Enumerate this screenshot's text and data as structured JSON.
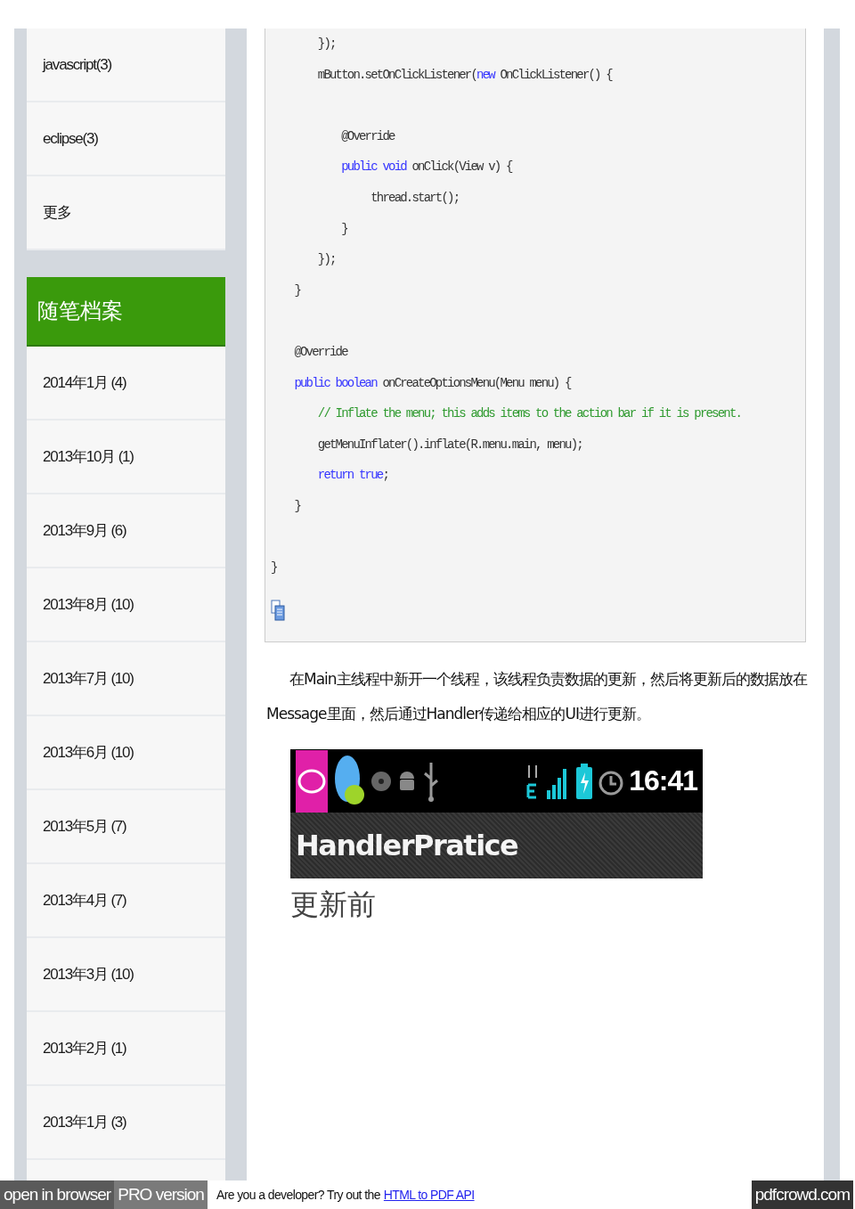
{
  "sidebar": {
    "categories": [
      {
        "label": "javascript(3)"
      },
      {
        "label": "eclipse(3)"
      },
      {
        "label": "更多"
      }
    ],
    "archive": {
      "title": "随笔档案",
      "items": [
        {
          "label": "2014年1月 (4)"
        },
        {
          "label": "2013年10月 (1)"
        },
        {
          "label": "2013年9月 (6)"
        },
        {
          "label": "2013年8月 (10)"
        },
        {
          "label": "2013年7月 (10)"
        },
        {
          "label": "2013年6月 (10)"
        },
        {
          "label": "2013年5月 (7)"
        },
        {
          "label": "2013年4月 (7)"
        },
        {
          "label": "2013年3月 (10)"
        },
        {
          "label": "2013年2月 (1)"
        },
        {
          "label": "2013年1月 (3)"
        }
      ]
    }
  },
  "code": {
    "lines": [
      {
        "kind": "code",
        "tokens": [
          {
            "text": "        });",
            "kind": "plain"
          }
        ]
      },
      {
        "kind": "code",
        "tokens": [
          {
            "text": "        mButton.setOnClickListener(",
            "kind": "plain"
          },
          {
            "text": "new",
            "kind": "keyword"
          },
          {
            "text": " OnClickListener() {",
            "kind": "plain"
          }
        ]
      },
      {
        "kind": "blank"
      },
      {
        "kind": "code",
        "tokens": [
          {
            "text": "            @Override",
            "kind": "plain"
          }
        ]
      },
      {
        "kind": "code",
        "tokens": [
          {
            "text": "            public void",
            "kind": "keyword"
          },
          {
            "text": " onClick(View v) {",
            "kind": "plain"
          }
        ]
      },
      {
        "kind": "code",
        "tokens": [
          {
            "text": "                 thread.start();",
            "kind": "plain"
          }
        ]
      },
      {
        "kind": "code",
        "tokens": [
          {
            "text": "            }",
            "kind": "plain"
          }
        ]
      },
      {
        "kind": "code",
        "tokens": [
          {
            "text": "        });",
            "kind": "plain"
          }
        ]
      },
      {
        "kind": "code",
        "tokens": [
          {
            "text": "    }",
            "kind": "plain"
          }
        ]
      },
      {
        "kind": "blank"
      },
      {
        "kind": "code",
        "tokens": [
          {
            "text": "    @Override",
            "kind": "plain"
          }
        ]
      },
      {
        "kind": "code",
        "tokens": [
          {
            "text": "    public boolean",
            "kind": "keyword"
          },
          {
            "text": " onCreateOptionsMenu(Menu menu) {",
            "kind": "plain"
          }
        ]
      },
      {
        "kind": "code",
        "tokens": [
          {
            "text": "        // Inflate the menu; this adds items to the action bar if it is present.",
            "kind": "comment"
          }
        ]
      },
      {
        "kind": "code",
        "tokens": [
          {
            "text": "        getMenuInflater().inflate(R.menu.main, menu);",
            "kind": "plain"
          }
        ]
      },
      {
        "kind": "code",
        "tokens": [
          {
            "text": "        return true",
            "kind": "keyword"
          },
          {
            "text": ";",
            "kind": "plain"
          }
        ]
      },
      {
        "kind": "code",
        "tokens": [
          {
            "text": "    }",
            "kind": "plain"
          }
        ]
      },
      {
        "kind": "blank"
      },
      {
        "kind": "code",
        "tokens": [
          {
            "text": "}",
            "kind": "plain"
          }
        ]
      }
    ]
  },
  "paragraph": "在Main主线程中新开一个线程，该线程负责数据的更新，然后将更新后的数据放在Message里面，然后通过Handler传递给相应的UI进行更新。",
  "app_screenshot": {
    "time": "16:41",
    "title": "HandlerPratice"
  },
  "caption": "更新前",
  "footer": {
    "open_in_browser": "open in browser",
    "pro": "PRO version",
    "promo": "Are you a developer? Try out the",
    "link": "HTML to PDF API",
    "brand": "pdfcrowd.com"
  }
}
